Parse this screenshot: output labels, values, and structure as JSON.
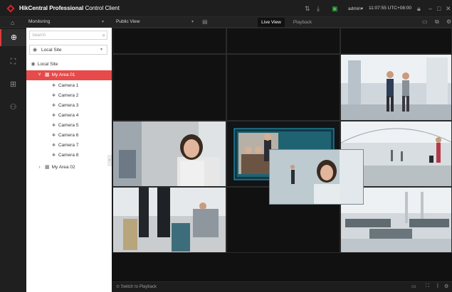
{
  "titlebar": {
    "brand": "HikCentral Professional",
    "title_suffix": "Control Client",
    "user": "admin",
    "user_caret": "▾",
    "time": "11:07:55 UTC+08:00",
    "icons": [
      "split-icon",
      "download-icon",
      "alarm-icon",
      "lock-icon",
      "minimize-icon",
      "maximize-icon",
      "close-icon"
    ]
  },
  "modulebar": {
    "module": "Monitoring",
    "view": "Public View",
    "tabs": [
      {
        "label": "Live View",
        "active": true
      },
      {
        "label": "Playback",
        "active": false
      }
    ]
  },
  "rail": {
    "items": [
      "globe-icon",
      "face-icon",
      "grid-icon",
      "person-icon"
    ],
    "active_index": 0
  },
  "panel": {
    "search_placeholder": "Search",
    "site_select": "Local Site",
    "tree": {
      "root": "Local Site",
      "areas": [
        {
          "name": "My Area 01",
          "expanded": true,
          "selected": true,
          "cameras": [
            "Camera 1",
            "Camera 2",
            "Camera 3",
            "Camera 4",
            "Camera 5",
            "Camera 6",
            "Camera 7",
            "Camera 8"
          ]
        },
        {
          "name": "My Area 02",
          "expanded": false,
          "selected": false
        }
      ]
    }
  },
  "statusbar": {
    "switch_label": "Switch to Playback"
  },
  "colors": {
    "brand_red": "#d9232a",
    "selected_row": "#e74a4a",
    "highlight_border": "#2aa6c9"
  }
}
